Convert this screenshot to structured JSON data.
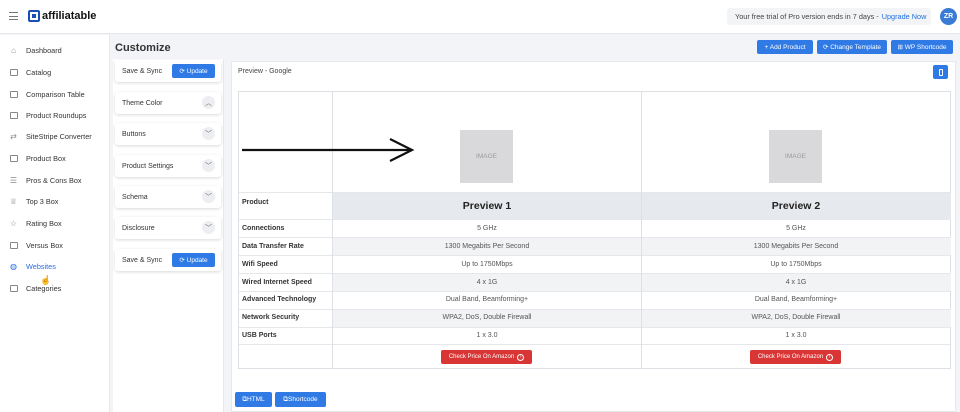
{
  "app": {
    "logo_text": "affiliatable",
    "user_initials": "ZR"
  },
  "trial": {
    "text": "Your free trial of Pro version ends in 7 days -",
    "link": "Upgrade Now"
  },
  "sidebar": {
    "items": [
      {
        "label": "Dashboard",
        "icon": "home-icon"
      },
      {
        "label": "Catalog",
        "icon": "catalog-icon"
      },
      {
        "label": "Comparison Table",
        "icon": "table-icon"
      },
      {
        "label": "Product Roundups",
        "icon": "roundup-icon"
      },
      {
        "label": "SiteStripe Converter",
        "icon": "convert-icon"
      },
      {
        "label": "Product Box",
        "icon": "box-icon"
      },
      {
        "label": "Pros & Cons Box",
        "icon": "list-icon"
      },
      {
        "label": "Top 3 Box",
        "icon": "trophy-icon"
      },
      {
        "label": "Rating Box",
        "icon": "star-icon"
      },
      {
        "label": "Versus Box",
        "icon": "versus-icon"
      },
      {
        "label": "Websites",
        "icon": "globe-icon",
        "active": true
      },
      {
        "label": "Categories",
        "icon": "folder-icon"
      }
    ]
  },
  "main": {
    "title": "Customize",
    "actions": {
      "add_product": "+ Add Product",
      "change_template": "⟳ Change Template",
      "wp_shortcode": "⊞ WP Shortcode"
    }
  },
  "settings": {
    "save_sync": "Save & Sync",
    "update": "⟳ Update",
    "sections": [
      "Theme Color",
      "Buttons",
      "Product Settings",
      "Schema",
      "Disclosure"
    ]
  },
  "preview": {
    "label": "Preview - Google",
    "image_placeholder": "IMAGE",
    "product_label": "Product",
    "products": [
      "Preview 1",
      "Preview 2"
    ],
    "rows": [
      {
        "label": "Connections",
        "values": [
          "5 GHz",
          "5 GHz"
        ]
      },
      {
        "label": "Data Transfer Rate",
        "values": [
          "1300 Megabits Per Second",
          "1300 Megabits Per Second"
        ]
      },
      {
        "label": "Wifi Speed",
        "values": [
          "Up to 1750Mbps",
          "Up to 1750Mbps"
        ]
      },
      {
        "label": "Wired Internet Speed",
        "values": [
          "4 x 1G",
          "4 x 1G"
        ]
      },
      {
        "label": "Advanced Technology",
        "values": [
          "Dual Band, Beamforming+",
          "Dual Band, Beamforming+"
        ]
      },
      {
        "label": "Network Security",
        "values": [
          "WPA2, DoS, Double Firewall",
          "WPA2, DoS, Double Firewall"
        ]
      },
      {
        "label": "USB Ports",
        "values": [
          "1 x 3.0",
          "1 x 3.0"
        ]
      }
    ],
    "cta": "Check Price On Amazon"
  },
  "bottom": {
    "html": "HTML",
    "shortcode": "Shortcode"
  },
  "colors": {
    "accent": "#2f7ae5",
    "cta": "#d93535"
  }
}
